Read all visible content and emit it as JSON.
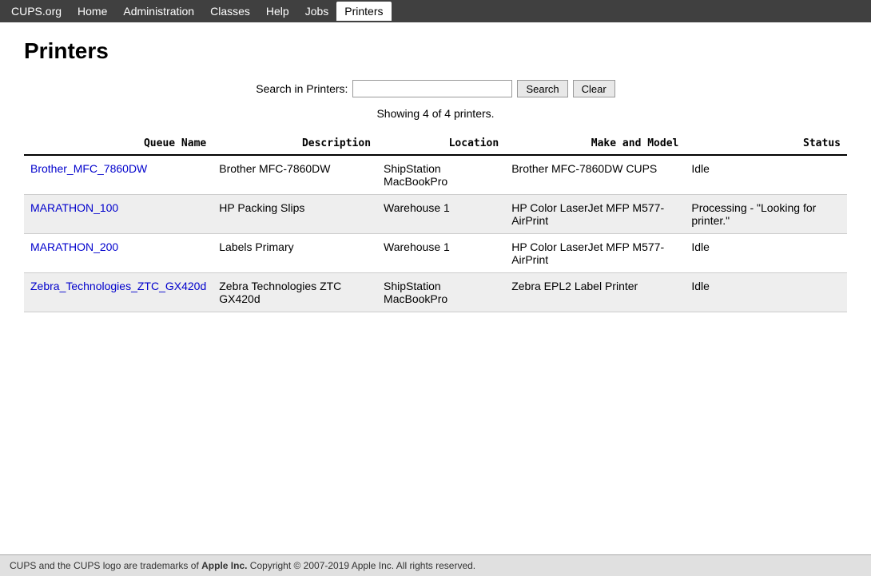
{
  "nav": {
    "items": [
      {
        "label": "CUPS.org",
        "href": "#",
        "active": false
      },
      {
        "label": "Home",
        "href": "#",
        "active": false
      },
      {
        "label": "Administration",
        "href": "#",
        "active": false
      },
      {
        "label": "Classes",
        "href": "#",
        "active": false
      },
      {
        "label": "Help",
        "href": "#",
        "active": false
      },
      {
        "label": "Jobs",
        "href": "#",
        "active": false
      },
      {
        "label": "Printers",
        "href": "#",
        "active": true
      }
    ]
  },
  "page": {
    "title": "Printers",
    "search_label": "Search in Printers:",
    "search_placeholder": "",
    "search_button": "Search",
    "clear_button": "Clear",
    "showing_text": "Showing 4 of 4 printers."
  },
  "table": {
    "columns": [
      "Queue Name",
      "Description",
      "Location",
      "Make and Model",
      "Status"
    ],
    "rows": [
      {
        "queue_name": "Brother_MFC_7860DW",
        "description": "Brother MFC-7860DW",
        "location": "ShipStation MacBookPro",
        "make_model": "Brother MFC-7860DW CUPS",
        "status": "Idle"
      },
      {
        "queue_name": "MARATHON_100",
        "description": "HP Packing Slips",
        "location": "Warehouse 1",
        "make_model": "HP Color LaserJet MFP M577-AirPrint",
        "status": "Processing - \"Looking for printer.\""
      },
      {
        "queue_name": "MARATHON_200",
        "description": "Labels Primary",
        "location": "Warehouse 1",
        "make_model": "HP Color LaserJet MFP M577-AirPrint",
        "status": "Idle"
      },
      {
        "queue_name": "Zebra_Technologies_ZTC_GX420d",
        "description": "Zebra Technologies ZTC GX420d",
        "location": "ShipStation MacBookPro",
        "make_model": "Zebra EPL2 Label Printer",
        "status": "Idle"
      }
    ]
  },
  "footer": {
    "text": "CUPS and the CUPS logo are trademarks of ",
    "brand": "Apple Inc.",
    "copyright": " Copyright © 2007-2019 Apple Inc. All rights reserved."
  }
}
